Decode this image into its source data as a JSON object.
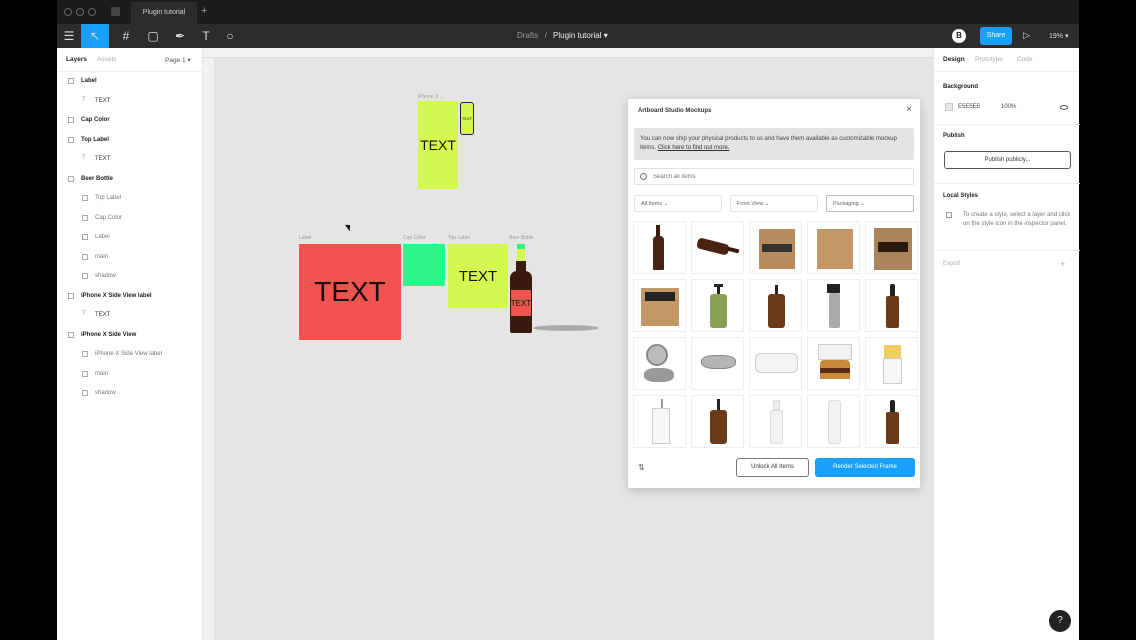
{
  "browser": {
    "tab_title": "Plugin tutorial",
    "new_tab": "+"
  },
  "toolbar": {
    "menu_icon": "☰",
    "move_icon": "↖",
    "frame_icon": "#",
    "shape_icon": "▢",
    "pen_icon": "✒",
    "text_icon": "T",
    "comment_icon": "○",
    "breadcrumb_team": "Drafts",
    "breadcrumb_sep": "/",
    "file_name": "Plugin tutorial ▾",
    "avatar": "B",
    "share_label": "Share",
    "play_icon": "▷",
    "zoom": "19% ▾"
  },
  "left_panel": {
    "tabs": {
      "layers": "Layers",
      "assets": "Assets",
      "page": "Page 1 ▾"
    },
    "layers": [
      {
        "label": "Label",
        "kind": "frame"
      },
      {
        "label": "TEXT",
        "kind": "text"
      },
      {
        "label": "Cap Color",
        "kind": "frame"
      },
      {
        "label": "Top Label",
        "kind": "frame"
      },
      {
        "label": "TEXT",
        "kind": "text"
      },
      {
        "label": "Beer Bottle",
        "kind": "frame"
      },
      {
        "label": "Top Label",
        "kind": "child"
      },
      {
        "label": "Cap Color",
        "kind": "child"
      },
      {
        "label": "Label",
        "kind": "child"
      },
      {
        "label": "main",
        "kind": "child"
      },
      {
        "label": "shadow",
        "kind": "child"
      },
      {
        "label": "iPhone X Side View label",
        "kind": "frame"
      },
      {
        "label": "TEXT",
        "kind": "text"
      },
      {
        "label": "iPhone X Side View",
        "kind": "frame"
      },
      {
        "label": "iPhone X Side View label",
        "kind": "child"
      },
      {
        "label": "main",
        "kind": "child"
      },
      {
        "label": "shadow",
        "kind": "child"
      }
    ]
  },
  "canvas": {
    "frames": {
      "iphone_label": "iPhone X ...",
      "iphone_text": "TEXT",
      "phone_text": "TEXT",
      "label_name": "Label",
      "label_text": "TEXT",
      "cap_name": "Cap Color",
      "top_label_name": "Top Label",
      "top_label_text": "TEXT",
      "bottle_name": "Beer Bottle",
      "bottle_text": "TEXT"
    },
    "colors": {
      "red": "#f25250",
      "green": "#2ef58a",
      "lime": "#d4f850",
      "bottle": "#5a2a1a"
    }
  },
  "plugin": {
    "title": "Artboard Studio Mockups",
    "close": "×",
    "notice_text": "You can now ship your physical products to us and have them available as customizable mockup items.",
    "notice_link": "Click here to find out more.",
    "search_placeholder": "Search all items",
    "filters": [
      "All Items ⌄",
      "Front View ⌄",
      "Packaging ⌄"
    ],
    "items": [
      "beer-bottle",
      "beer-bottle-lying",
      "six-pack-carton",
      "six-pack-carton",
      "six-pack-carton-open",
      "carton-box",
      "pump-bottle",
      "pump-bottle-amber",
      "spray-bottle",
      "dropper-bottle",
      "tin-can-open",
      "tin-can",
      "food-container",
      "burger-box",
      "fries-cup",
      "paper-cup",
      "pump-bottle-amber",
      "white-bottle",
      "white-tube",
      "dropper-bottle"
    ],
    "unlock_label": "Unlock All Items",
    "render_label": "Render Selected Frame"
  },
  "right_panel": {
    "tabs": {
      "design": "Design",
      "prototype": "Prototype",
      "code": "Code"
    },
    "background_title": "Background",
    "bg_hex": "E5E5E5",
    "bg_opacity": "100%",
    "publish_title": "Publish",
    "publish_button": "Publish publicly...",
    "local_styles_title": "Local Styles",
    "local_styles_text": "To create a style, select a layer and click on the style icon in the inspector panel.",
    "export_title": "Export",
    "export_plus": "+"
  },
  "help": "?"
}
